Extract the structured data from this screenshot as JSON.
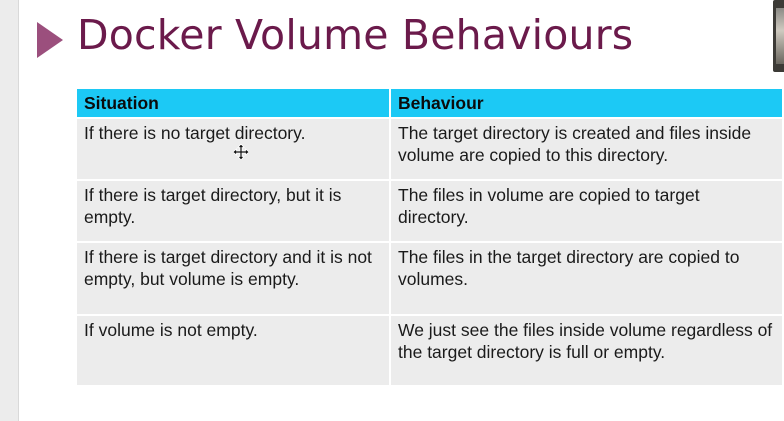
{
  "slide": {
    "title": "Docker Volume Behaviours"
  },
  "table": {
    "headers": [
      "Situation",
      "Behaviour"
    ],
    "rows": [
      {
        "situation": "If there is no target directory.",
        "behaviour": "The target directory is created and files inside volume are copied to this directory."
      },
      {
        "situation": "If there is target directory, but it is empty.",
        "behaviour": "The files in volume are copied to target directory."
      },
      {
        "situation": "If there is target directory and it is not empty, but volume is empty.",
        "behaviour": "The files in the target directory are copied to volumes."
      },
      {
        "situation": "If volume is not empty.",
        "behaviour": "We just see the files inside volume regardless of  the target directory is full or empty."
      }
    ]
  },
  "colors": {
    "title": "#6b1a4b",
    "bullet_arrow": "#9b4f7d",
    "header_fill": "#1cc9f5",
    "row_fill": "#ececec"
  },
  "icons": {
    "title_marker": "triangle-bullet-icon",
    "pointer": "move-cursor-icon"
  }
}
